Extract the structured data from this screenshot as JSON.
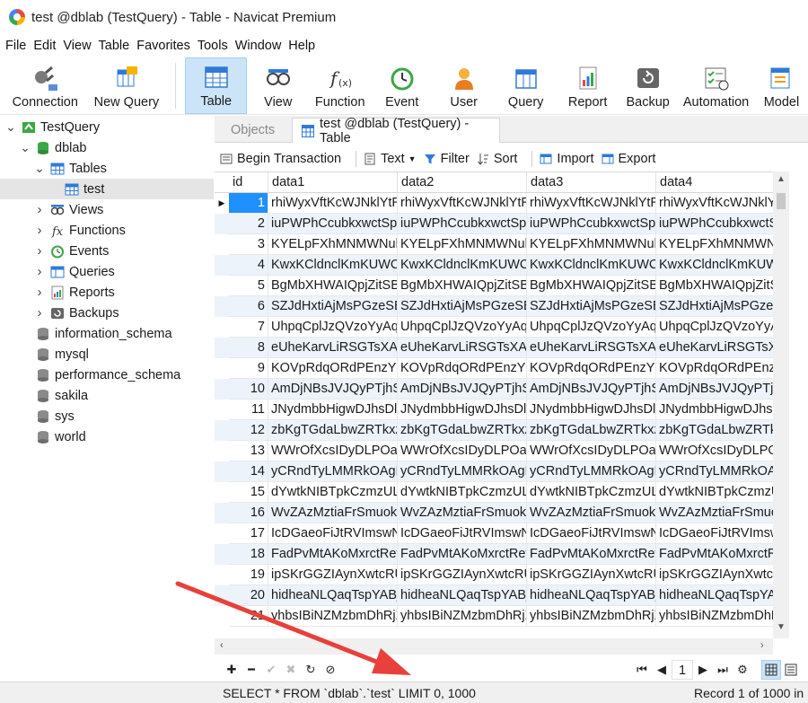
{
  "window": {
    "title": "test @dblab (TestQuery) - Table - Navicat Premium"
  },
  "menu": [
    "File",
    "Edit",
    "View",
    "Table",
    "Favorites",
    "Tools",
    "Window",
    "Help"
  ],
  "toolbar": [
    {
      "label": "Connection",
      "icon": "connection-icon"
    },
    {
      "label": "New Query",
      "icon": "new-query-icon"
    },
    {
      "label": "Table",
      "icon": "table-icon",
      "active": true
    },
    {
      "label": "View",
      "icon": "view-icon"
    },
    {
      "label": "Function",
      "icon": "function-icon"
    },
    {
      "label": "Event",
      "icon": "event-icon"
    },
    {
      "label": "User",
      "icon": "user-icon"
    },
    {
      "label": "Query",
      "icon": "query-icon"
    },
    {
      "label": "Report",
      "icon": "report-icon"
    },
    {
      "label": "Backup",
      "icon": "backup-icon"
    },
    {
      "label": "Automation",
      "icon": "automation-icon"
    },
    {
      "label": "Model",
      "icon": "model-icon"
    }
  ],
  "tree": [
    {
      "label": "TestQuery",
      "level": 0,
      "arrow": "open",
      "icon": "connection"
    },
    {
      "label": "dblab",
      "level": 1,
      "arrow": "open",
      "icon": "db-green"
    },
    {
      "label": "Tables",
      "level": 2,
      "arrow": "open",
      "icon": "tables"
    },
    {
      "label": "test",
      "level": 3,
      "arrow": "",
      "icon": "table",
      "selected": true
    },
    {
      "label": "Views",
      "level": 2,
      "arrow": "closed",
      "icon": "views"
    },
    {
      "label": "Functions",
      "level": 2,
      "arrow": "closed",
      "icon": "functions"
    },
    {
      "label": "Events",
      "level": 2,
      "arrow": "closed",
      "icon": "events"
    },
    {
      "label": "Queries",
      "level": 2,
      "arrow": "closed",
      "icon": "queries"
    },
    {
      "label": "Reports",
      "level": 2,
      "arrow": "closed",
      "icon": "reports"
    },
    {
      "label": "Backups",
      "level": 2,
      "arrow": "closed",
      "icon": "backups"
    },
    {
      "label": "information_schema",
      "level": 1,
      "arrow": "",
      "icon": "db-gray"
    },
    {
      "label": "mysql",
      "level": 1,
      "arrow": "",
      "icon": "db-gray"
    },
    {
      "label": "performance_schema",
      "level": 1,
      "arrow": "",
      "icon": "db-gray"
    },
    {
      "label": "sakila",
      "level": 1,
      "arrow": "",
      "icon": "db-gray"
    },
    {
      "label": "sys",
      "level": 1,
      "arrow": "",
      "icon": "db-gray"
    },
    {
      "label": "world",
      "level": 1,
      "arrow": "",
      "icon": "db-gray"
    }
  ],
  "tabs": {
    "objects": "Objects",
    "active": "test @dblab (TestQuery) - Table"
  },
  "gridtools": {
    "begin_transaction": "Begin Transaction",
    "text": "Text",
    "filter": "Filter",
    "sort": "Sort",
    "import": "Import",
    "export": "Export"
  },
  "grid": {
    "columns": [
      "id",
      "data1",
      "data2",
      "data3",
      "data4"
    ],
    "rows": [
      [
        "1",
        "rhiWyxVftKcWJNklYtRh"
      ],
      [
        "2",
        "iuPWPhCcubkxwctSpPW"
      ],
      [
        "3",
        "KYELpFXhMNMWNulhw"
      ],
      [
        "4",
        "KwxKCldnclKmKUWCm"
      ],
      [
        "5",
        "BgMbXHWAIQpjZitSBo"
      ],
      [
        "6",
        "SZJdHxtiAjMsPGzeSEu"
      ],
      [
        "7",
        "UhpqCplJzQVzoYyAqnr"
      ],
      [
        "8",
        "eUheKarvLiRSGTsXAiq"
      ],
      [
        "9",
        "KOVpRdqORdPEnzYGC"
      ],
      [
        "10",
        "AmDjNBsJVJQyPTjhSRl"
      ],
      [
        "11",
        "JNydmbbHigwDJhsDlkd"
      ],
      [
        "12",
        "zbKgTGdaLbwZRTkxzz"
      ],
      [
        "13",
        "WWrOfXcsIDyDLPOaD"
      ],
      [
        "14",
        "yCRndTyLMMRkOAgEAl"
      ],
      [
        "15",
        "dYwtkNIBTpkCzmzULyv"
      ],
      [
        "16",
        "WvZAzMztiaFrSmuoki"
      ],
      [
        "17",
        "IcDGaeoFiJtRVImswNN"
      ],
      [
        "18",
        "FadPvMtAKoMxrctRetz"
      ],
      [
        "19",
        "ipSKrGGZIAynXwtcRUH"
      ],
      [
        "20",
        "hidheaNLQaqTspYABjl"
      ],
      [
        "21",
        "yhbsIBiNZMzbmDhRjXe"
      ]
    ]
  },
  "pager": {
    "page": "1"
  },
  "status": {
    "sql": "SELECT * FROM `dblab`.`test` LIMIT 0, 1000",
    "record": "Record 1 of 1000 in"
  }
}
